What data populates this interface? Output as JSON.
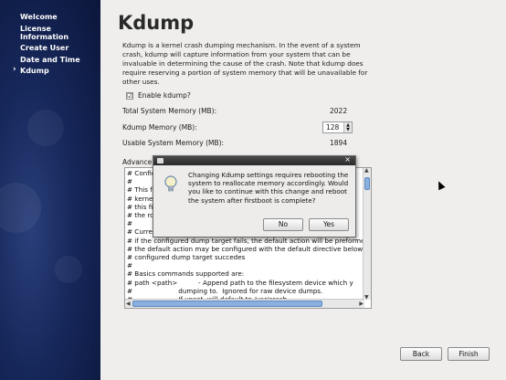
{
  "sidebar": {
    "items": [
      {
        "label": "Welcome",
        "active": false
      },
      {
        "label": "License",
        "active": false
      },
      {
        "label": "Information",
        "active": false
      },
      {
        "label": "Create User",
        "active": false
      },
      {
        "label": "Date and Time",
        "active": false
      },
      {
        "label": "Kdump",
        "active": true
      }
    ]
  },
  "main": {
    "title": "Kdump",
    "intro": "Kdump is a kernel crash dumping mechanism. In the event of a system crash, kdump will capture information from your system that can be invaluable in determining the cause of the crash. Note that kdump does require reserving a portion of system memory that will be unavailable for other uses.",
    "enable_label": "Enable kdump?",
    "enable_checked": "☑",
    "total_label": "Total System Memory (MB):",
    "total_value": "2022",
    "kdump_label": "Kdump Memory (MB):",
    "kdump_value": "128",
    "usable_label": "Usable System Memory (MB):",
    "usable_value": "1894",
    "advanced_label": "Advance",
    "config_lines": [
      "# Config",
      "#",
      "# This f",
      "# kerne",
      "# this fi",
      "# the ro",
      "#",
      "# Curre",
      "# if the configured dump target fails, the default action will be preforme",
      "# the default action may be configured with the default directive below",
      "# configured dump target succedes",
      "#",
      "# Basics commands supported are:",
      "# path <path>          - Append path to the filesystem device which y",
      "#                      dumping to.  Ignored for raw device dumps.",
      "#                      If unset, will default to /var/crash.",
      "#"
    ]
  },
  "dialog": {
    "message": "Changing Kdump settings requires rebooting the system to reallocate memory accordingly. Would you like to continue with this change and reboot the system after firstboot is complete?",
    "close_glyph": "×",
    "no_label": "No",
    "yes_label": "Yes"
  },
  "nav": {
    "back_label": "Back",
    "finish_label": "Finish"
  },
  "colors": {
    "sidebar": "#16275a",
    "scroll_accent": "#8ab0dd"
  }
}
